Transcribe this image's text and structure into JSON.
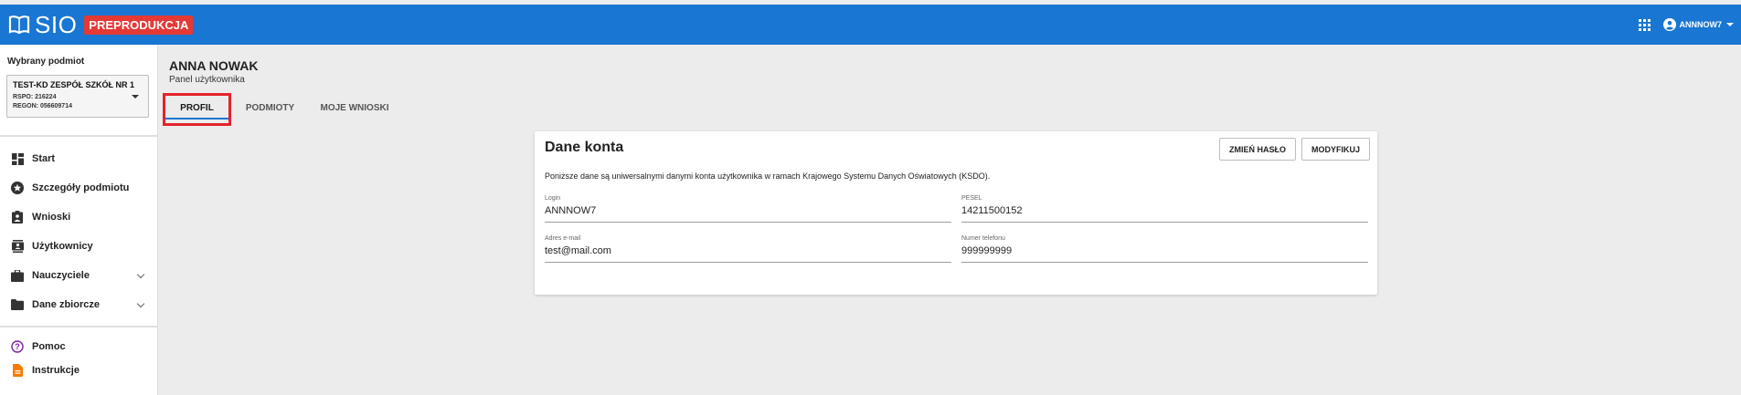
{
  "header": {
    "logo_text": "SIO",
    "env_badge": "PREPRODUKCJA",
    "username": "ANNNOW7",
    "colors": {
      "primary": "#1976d2",
      "badge": "#e53935"
    }
  },
  "sidebar": {
    "selected_label": "Wybrany podmiot",
    "subject": {
      "name": "TEST-KD ZESPÓŁ SZKÓŁ NR 1",
      "rspo": "RSPO: 216224",
      "regon": "REGON: 056609714"
    },
    "nav": [
      {
        "label": "Start",
        "icon": "dashboard-icon"
      },
      {
        "label": "Szczegóły podmiotu",
        "icon": "star-badge-icon"
      },
      {
        "label": "Wnioski",
        "icon": "clipboard-icon"
      },
      {
        "label": "Użytkownicy",
        "icon": "contacts-icon"
      },
      {
        "label": "Nauczyciele",
        "icon": "briefcase-icon"
      },
      {
        "label": "Dane zbiorcze",
        "icon": "folder-icon"
      }
    ],
    "help": [
      {
        "label": "Pomoc",
        "icon": "help-circle-icon"
      },
      {
        "label": "Instrukcje",
        "icon": "document-icon"
      }
    ]
  },
  "page": {
    "title": "ANNA NOWAK",
    "subtitle": "Panel użytkownika",
    "tabs": [
      "PROFIL",
      "PODMIOTY",
      "MOJE WNIOSKI"
    ],
    "active_tab": "PROFIL"
  },
  "card": {
    "title": "Dane konta",
    "change_password": "ZMIEŃ HASŁO",
    "modify": "MODYFIKUJ",
    "description": "Poniższe dane są uniwersalnymi danymi konta użytkownika w ramach Krajowego Systemu Danych Oświatowych (KSDO).",
    "fields": {
      "login": {
        "label": "Login",
        "value": "ANNNOW7"
      },
      "pesel": {
        "label": "PESEL",
        "value": "14211500152"
      },
      "email": {
        "label": "Adres e-mail",
        "value": "test@mail.com"
      },
      "phone": {
        "label": "Numer telefonu",
        "value": "999999999"
      }
    }
  }
}
